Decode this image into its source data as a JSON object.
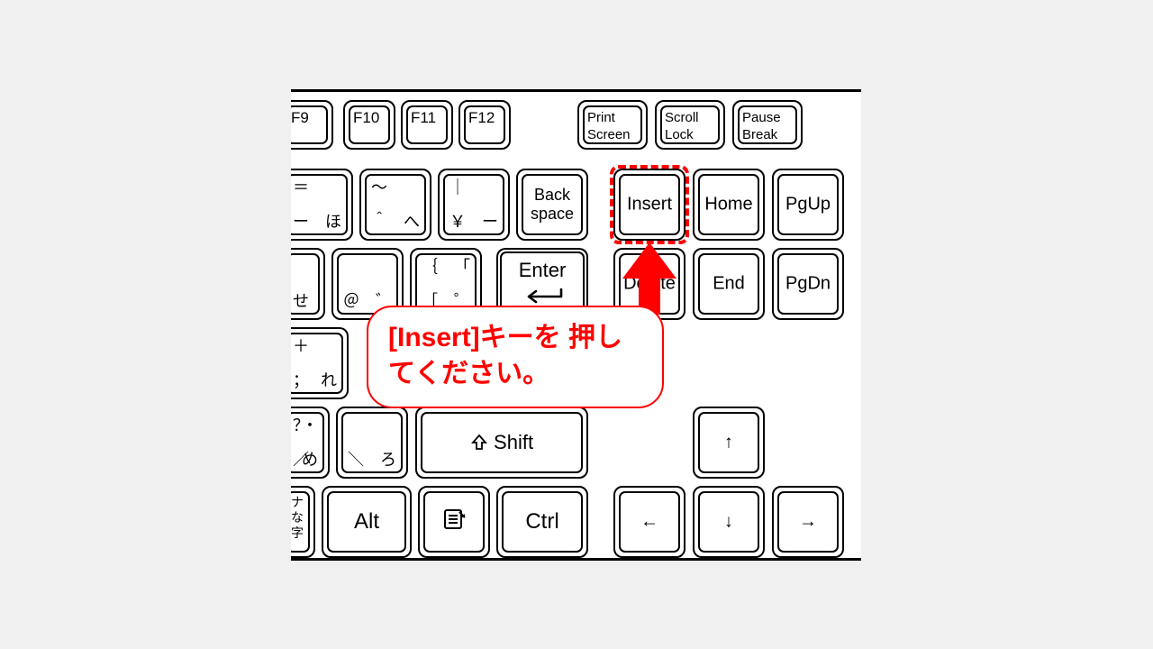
{
  "frow": {
    "f9": "F9",
    "f10": "F10",
    "f11": "F11",
    "f12": "F12",
    "prt": "Print\nScreen",
    "scl": "Scroll\nLock",
    "pbs": "Pause\nBreak"
  },
  "r1": {
    "k1": {
      "tl": "＝",
      "bl": "ー",
      "br": "ほ"
    },
    "k2": {
      "tl": "～",
      "bl": "＾",
      "br": "へ"
    },
    "k3": {
      "tl": "｜",
      "bl": "￥",
      "br": "ー"
    },
    "back": "Back\nspace",
    "insert": "Insert",
    "home": "Home",
    "pgup": "PgUp"
  },
  "r2": {
    "k1": {
      "bl": "せ",
      "tr": ""
    },
    "k2": {
      "tl": "",
      "bl": "＠",
      "br": "゛"
    },
    "k3": {
      "tl": "｛",
      "tr": "「",
      "bl": "［",
      "br": "゜"
    },
    "enter": "Enter",
    "delete": "Delete",
    "end": "End",
    "pgdn": "PgDn"
  },
  "r3": {
    "k1": {
      "tl": "＋",
      "bl": "；",
      "br": "れ"
    }
  },
  "r4": {
    "k1": {
      "tl": "？",
      "tr": "・",
      "bl": "／",
      "br": "め"
    },
    "k2": {
      "bl": "＼",
      "br": "ろ"
    },
    "shift": "Shift",
    "up": "↑"
  },
  "r5": {
    "kana": "ナ\nな\n字",
    "alt": "Alt",
    "ctrl": "Ctrl",
    "left": "←",
    "down": "↓",
    "right": "→"
  },
  "callout": {
    "text": "[Insert]キーを\n押してください。"
  }
}
